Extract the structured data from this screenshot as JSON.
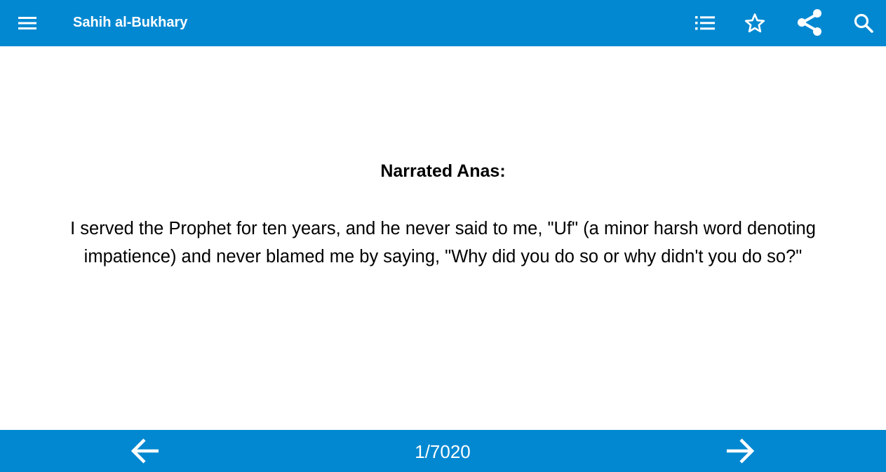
{
  "app_bar": {
    "title": "Sahih al-Bukhary",
    "icons": {
      "menu": "menu-icon",
      "list": "list-icon",
      "favorite": "star-outline-icon",
      "share": "share-icon",
      "search": "search-icon"
    },
    "background_color": "#0288d1"
  },
  "hadith": {
    "narrator": "Narrated Anas:",
    "text": "I served the Prophet for ten years, and he never said to me, \"Uf\" (a minor harsh word denoting impatience) and never blamed me by saying, \"Why did you do so or why didn't you do so?\""
  },
  "nav_bar": {
    "current": 1,
    "total": 7020,
    "page_label": "1/7020",
    "icons": {
      "previous": "arrow-left-icon",
      "next": "arrow-right-icon"
    },
    "background_color": "#0288d1"
  }
}
